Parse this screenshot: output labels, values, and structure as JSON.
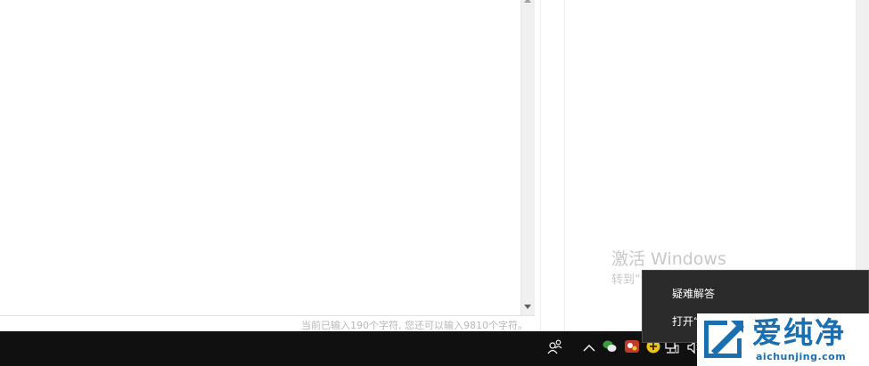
{
  "editor": {
    "char_count_text": "当前已输入190个字符, 您还可以输入9810个字符。"
  },
  "activation": {
    "title": "激活 Windows",
    "subtitle": "转到“设置”以激活 Windows。"
  },
  "context_menu": {
    "items": [
      {
        "label": "疑难解答"
      },
      {
        "label": "打开“"
      }
    ]
  },
  "taskbar": {
    "tray_icons": [
      "people-icon",
      "chevron-up-icon",
      "wechat-icon",
      "game-icon",
      "yellow-app-icon",
      "network-icon",
      "speaker-icon"
    ]
  },
  "logo": {
    "cn_text": "爱纯净",
    "en_text": "aichunjing.com",
    "color": "#1a6fb0"
  }
}
